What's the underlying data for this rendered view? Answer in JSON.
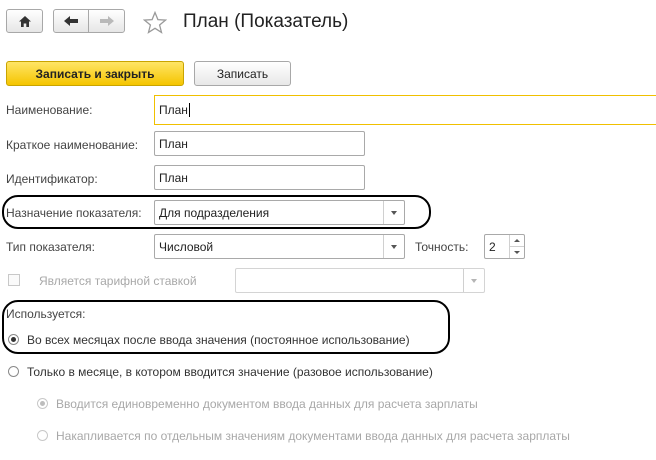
{
  "toolbar": {
    "home_icon": "home-icon",
    "back_icon": "arrow-left-icon",
    "forward_icon": "arrow-right-icon",
    "favorite_icon": "star-icon"
  },
  "window": {
    "title": "План (Показатель)"
  },
  "actions": {
    "save_close_label": "Записать и закрыть",
    "save_label": "Записать"
  },
  "form": {
    "name_label": "Наименование:",
    "name_value": "План",
    "short_name_label": "Краткое наименование:",
    "short_name_value": "План",
    "identifier_label": "Идентификатор:",
    "identifier_value": "План",
    "purpose_label": "Назначение показателя:",
    "purpose_value": "Для подразделения",
    "type_label": "Тип показателя:",
    "type_value": "Числовой",
    "precision_label": "Точность:",
    "precision_value": "2",
    "tariff_label": "Является тарифной ставкой",
    "tariff_checked": false,
    "tariff_value": ""
  },
  "usage": {
    "label": "Используется:",
    "options": [
      {
        "label": "Во всех месяцах после ввода значения (постоянное использование)",
        "selected": true
      },
      {
        "label": "Только в месяце, в котором вводится значение (разовое использование)",
        "selected": false
      }
    ],
    "sub_options": [
      {
        "label": "Вводится единовременно документом ввода данных для расчета зарплаты",
        "selected": true,
        "enabled": false
      },
      {
        "label": "Накапливается по отдельным значениям документами ввода данных для расчета зарплаты",
        "selected": false,
        "enabled": false
      }
    ]
  }
}
